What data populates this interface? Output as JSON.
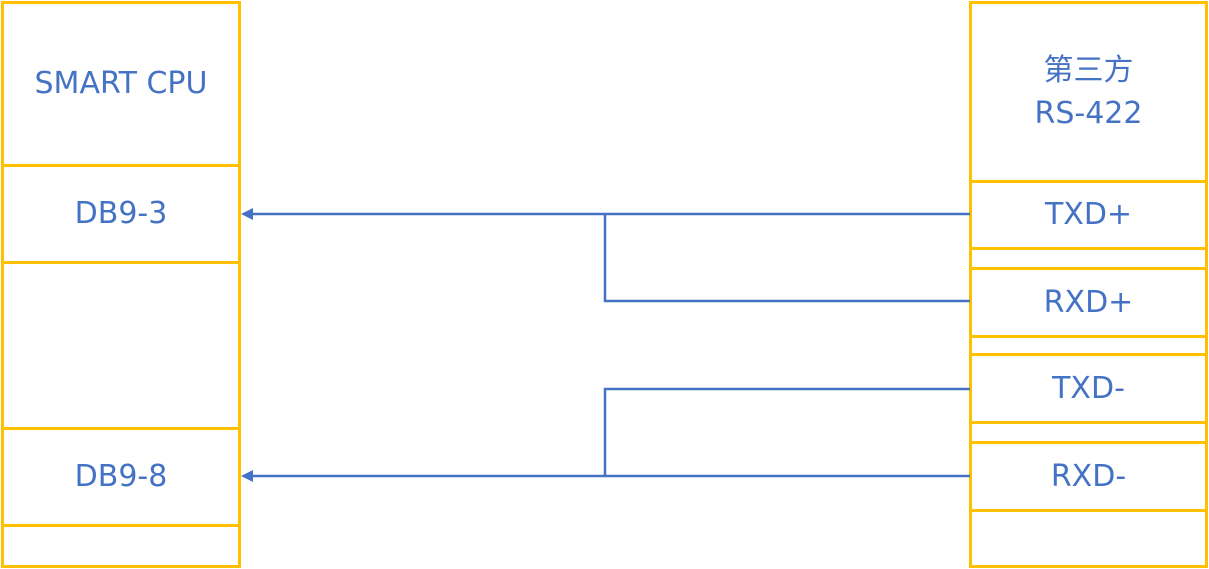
{
  "colors": {
    "box_border": "#FFC000",
    "text": "#4472C4",
    "wire": "#4472C4"
  },
  "left_block": {
    "title": "SMART CPU",
    "pins": [
      "DB9-3",
      "",
      "DB9-8",
      ""
    ]
  },
  "right_block": {
    "title_line1": "第三方",
    "title_line2": "RS-422",
    "pins": [
      "TXD+",
      "",
      "RXD+",
      "",
      "TXD-",
      "",
      "RXD-",
      ""
    ]
  },
  "connections": [
    {
      "from": [
        "TXD+",
        "RXD+"
      ],
      "to": "DB9-3"
    },
    {
      "from": [
        "TXD-",
        "RXD-"
      ],
      "to": "DB9-8"
    }
  ]
}
